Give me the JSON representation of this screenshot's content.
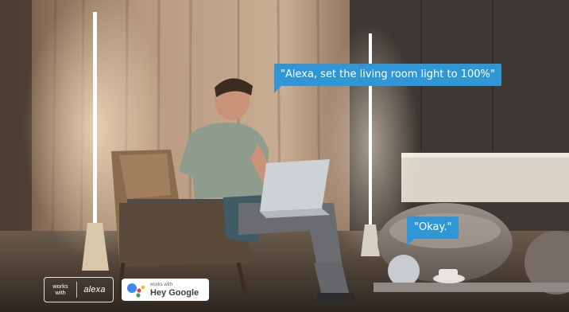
{
  "bubbles": {
    "alexa_command": "\"Alexa, set the living room light to 100%\"",
    "reply": "\"Okay.\""
  },
  "badges": {
    "alexa": {
      "works": "works",
      "with": "with",
      "brand": "alexa"
    },
    "google": {
      "small": "works with",
      "big": "Hey Google"
    }
  },
  "colors": {
    "bubble": "#2f97d6",
    "lamp_glow": "#ffffff",
    "warm_light": "#e9c9a3"
  },
  "icons": {
    "assistant": "google-assistant-icon"
  }
}
